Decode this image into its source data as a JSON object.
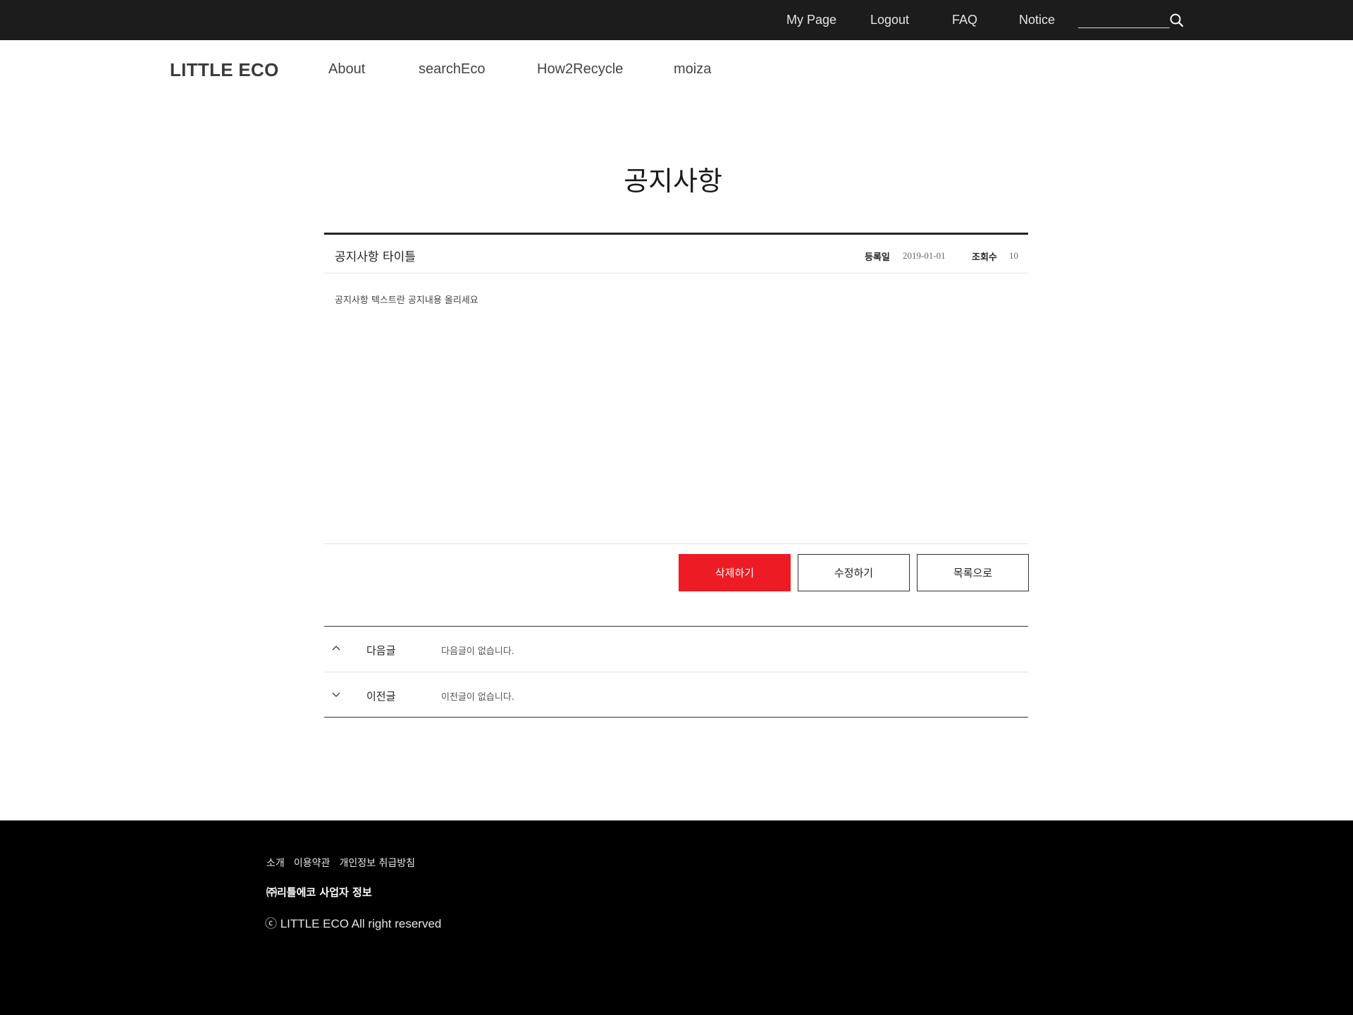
{
  "topbar": {
    "links": [
      "My Page",
      "Logout",
      "FAQ",
      "Notice"
    ],
    "search_placeholder": ""
  },
  "header": {
    "logo": "LITTLE ECO",
    "nav": [
      "About",
      "searchEco",
      "How2Recycle",
      "moiza"
    ]
  },
  "page": {
    "title": "공지사항"
  },
  "article": {
    "title": "공지사항 타이틀",
    "date_label": "등록일",
    "date": "2019-01-01",
    "views_label": "조회수",
    "views": "10",
    "body": "공지사항 텍스트란 공지내용 올리세요"
  },
  "buttons": {
    "delete": "삭제하기",
    "edit": "수정하기",
    "list": "목록으로"
  },
  "pager": {
    "next_label": "다음글",
    "next_text": "다음글이 없습니다.",
    "prev_label": "이전글",
    "prev_text": "이전글이 없습니다."
  },
  "footer": {
    "links": [
      "소개",
      "이용약관",
      "개인정보 취급방침"
    ],
    "company": "㈜리틀에코 사업자 정보",
    "copyright": "ⓒ LITTLE ECO  All right reserved"
  },
  "colors": {
    "topbar_bg": "#1c1c1c",
    "footer_bg": "#000000",
    "accent_red": "#ed1c24"
  }
}
